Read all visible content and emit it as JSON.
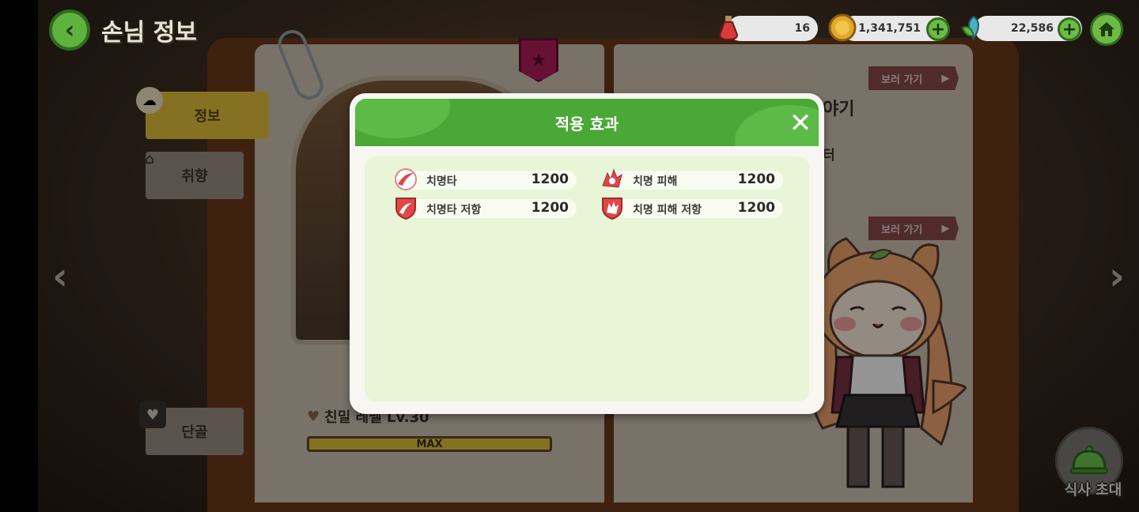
{
  "header": {
    "title": "손님 정보",
    "back_icon": "chevron-left-icon"
  },
  "currencies": [
    {
      "icon": "potion-icon",
      "value": "16",
      "has_plus": false
    },
    {
      "icon": "coin-icon",
      "value": "1,341,751",
      "has_plus": true
    },
    {
      "icon": "leaf-gem-icon",
      "value": "22,586",
      "has_plus": true
    }
  ],
  "home_icon": "home-icon",
  "sidebar": {
    "tabs": [
      {
        "label": "정보",
        "active": true
      },
      {
        "label": "취향",
        "active": false
      },
      {
        "label": "단골",
        "active": false
      }
    ]
  },
  "left_page": {
    "affinity_label": "친밀 레벨 Lv.30",
    "affinity_max": "MAX",
    "affinity_progress": 1.0
  },
  "right_page": {
    "title_fragment": "야기",
    "subtitle_fragment": "터",
    "go_button_1": "보러 가기",
    "go_button_2": "보러 가기"
  },
  "dine_button": "식사 초대",
  "modal": {
    "title": "적용 효과",
    "effects": [
      {
        "icon": "crit-icon",
        "name": "치명타",
        "value": "1200"
      },
      {
        "icon": "crit-damage-icon",
        "name": "치명 피해",
        "value": "1200"
      },
      {
        "icon": "crit-resist-icon",
        "name": "치명타 저항",
        "value": "1200"
      },
      {
        "icon": "crit-damage-resist-icon",
        "name": "치명 피해 저항",
        "value": "1200"
      }
    ]
  },
  "colors": {
    "accent_green": "#4aa836",
    "tab_active": "#e7c33c",
    "modal_body": "#e8f5d6"
  }
}
